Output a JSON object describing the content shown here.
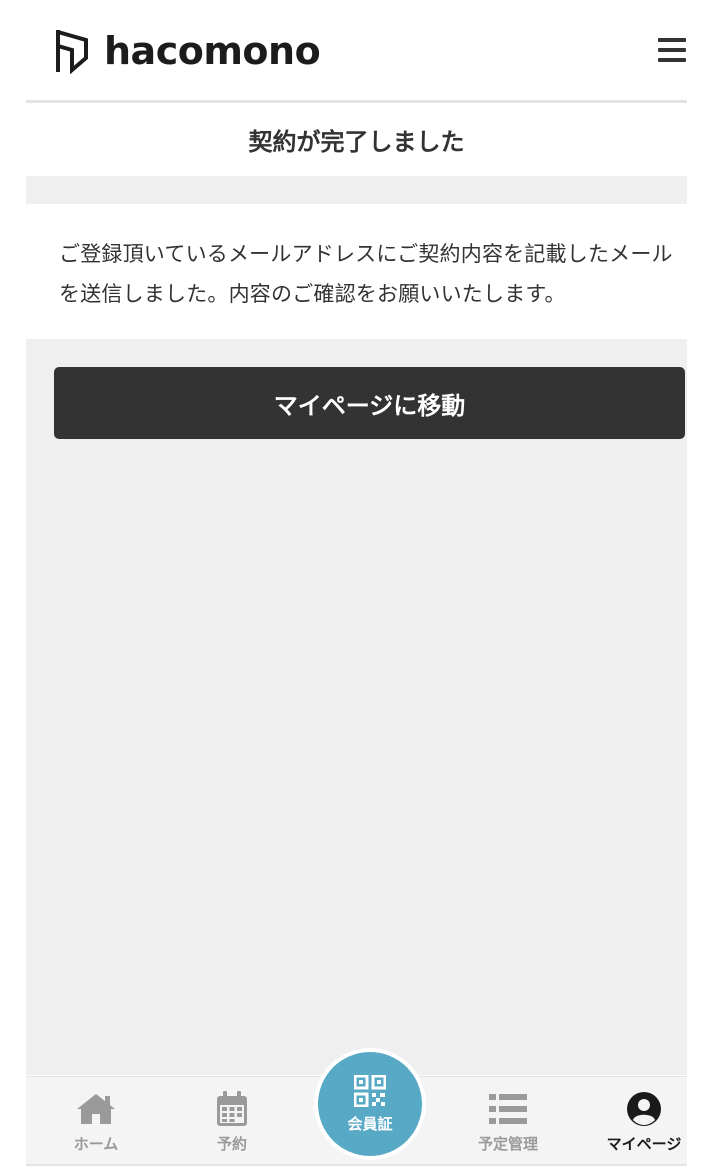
{
  "header": {
    "logo_text": "hacomono",
    "menu_icon": "hamburger-menu-icon"
  },
  "page": {
    "title": "契約が完了しました",
    "message": "ご登録頂いているメールアドレスにご契約内容を記載したメールを送信しました。内容のご確認をお願いいたします。",
    "cta_label": "マイページに移動"
  },
  "bottom_nav": {
    "items": [
      {
        "label": "ホーム",
        "icon": "home-icon"
      },
      {
        "label": "予約",
        "icon": "calendar-icon"
      },
      {
        "label": "会員証",
        "icon": "qr-code-icon"
      },
      {
        "label": "予定管理",
        "icon": "list-icon"
      },
      {
        "label": "マイページ",
        "icon": "user-circle-icon"
      }
    ],
    "active_index": 4
  },
  "colors": {
    "accent": "#57a9c6",
    "button_dark": "#333333",
    "background": "#efefef",
    "nav_inactive": "#9a9a9a"
  }
}
